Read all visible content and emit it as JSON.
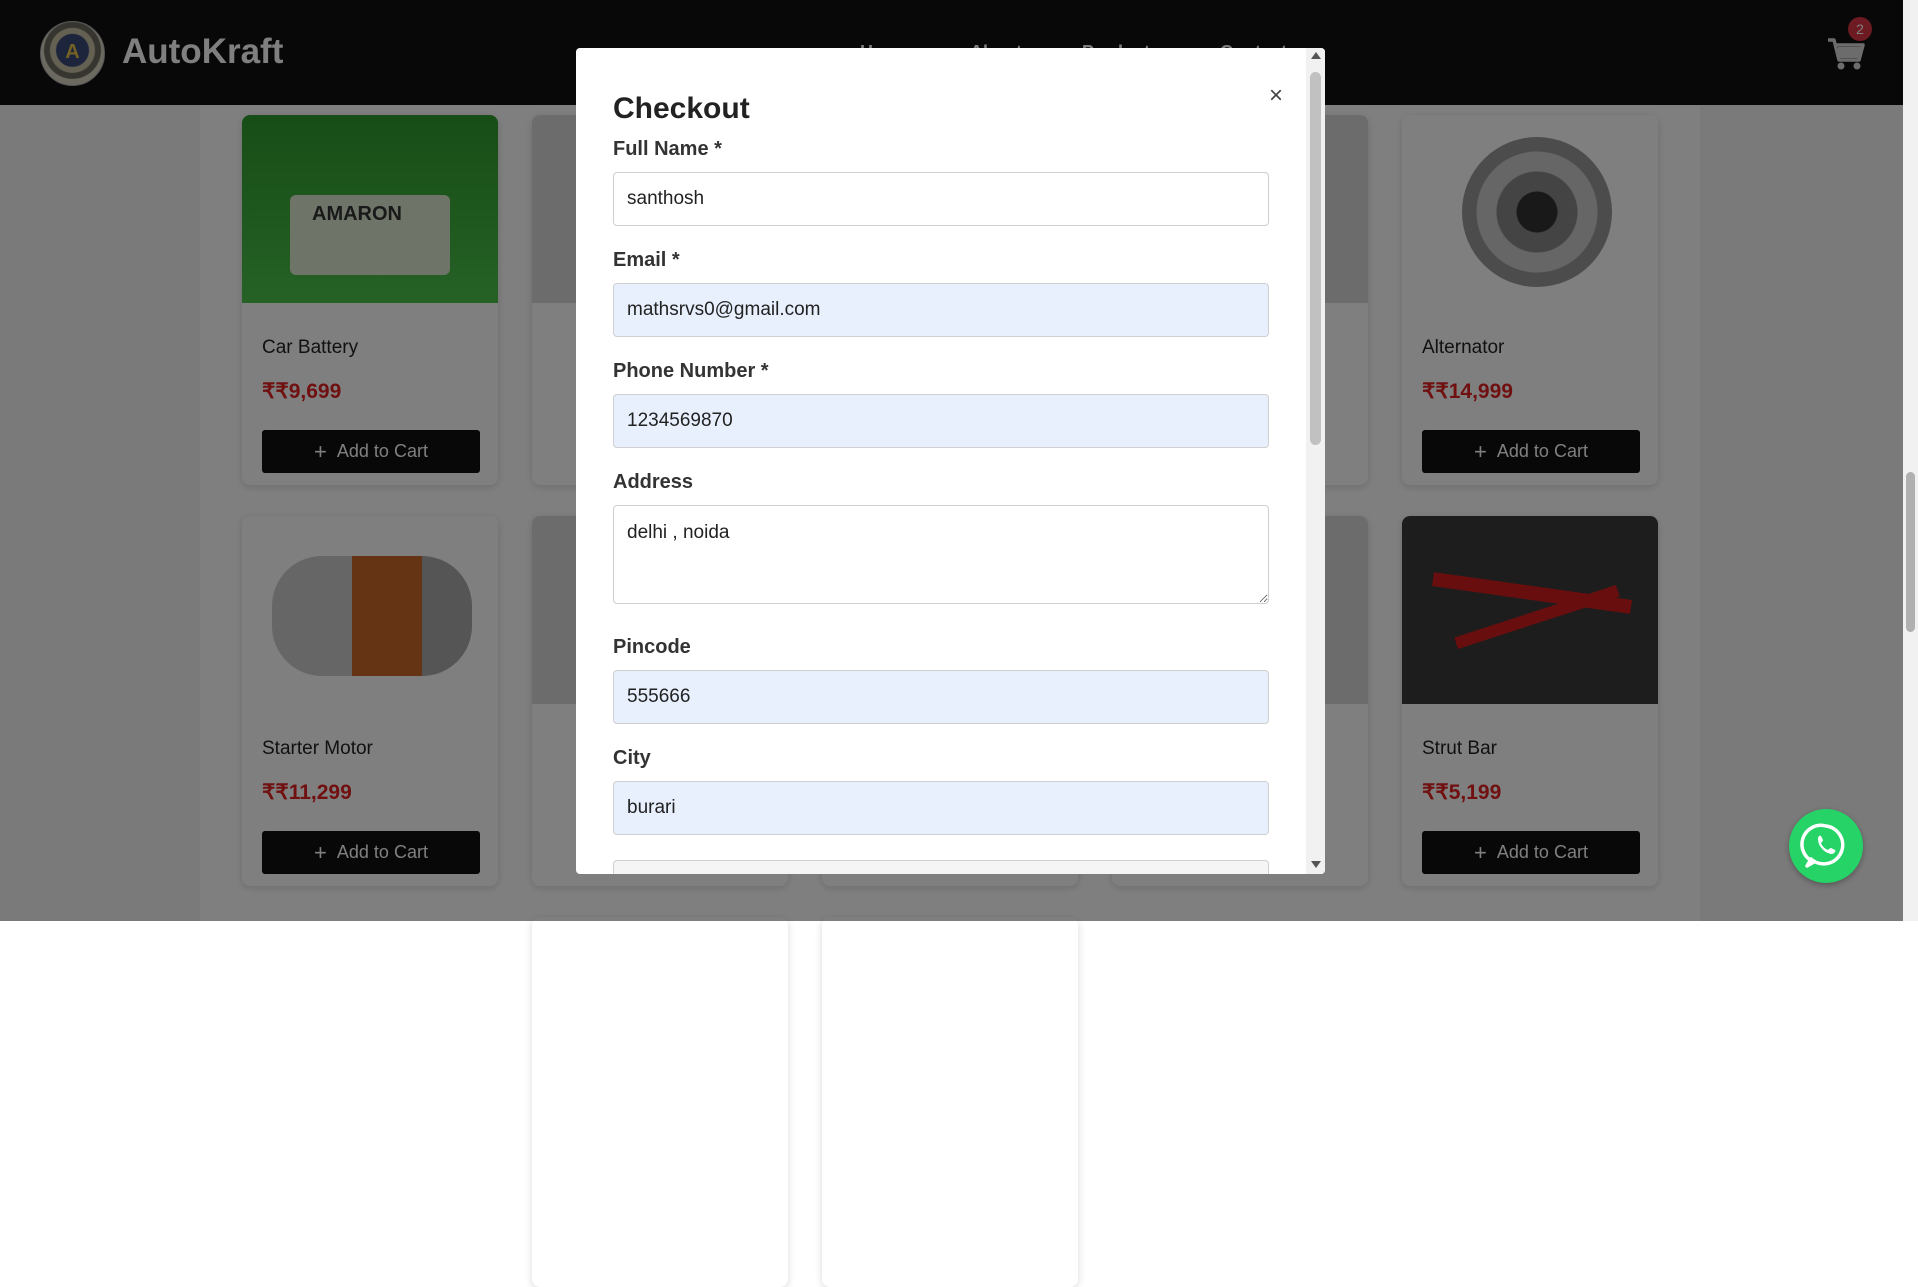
{
  "header": {
    "brand": "AutoKraft",
    "nav": [
      "Home",
      "About",
      "Products",
      "Contact"
    ],
    "cart_count": "2"
  },
  "products": [
    {
      "name": "Car Battery",
      "price": "₹₹9,699",
      "button": "Add to Cart",
      "image_text": "AMARON"
    },
    {
      "name": "Alternator",
      "price": "₹₹14,999",
      "button": "Add to Cart"
    },
    {
      "name": "Starter Motor",
      "price": "₹₹11,299",
      "button": "Add to Cart"
    },
    {
      "name": "Strut Bar",
      "price": "₹₹5,199",
      "button": "Add to Cart"
    }
  ],
  "checkout": {
    "title": "Checkout",
    "close": "×",
    "fields": [
      {
        "label": "Full Name *",
        "value": "santhosh"
      },
      {
        "label": "Email *",
        "value": "mathsrvs0@gmail.com"
      },
      {
        "label": "Phone Number *",
        "value": "1234569870"
      },
      {
        "label": "Address",
        "value": "delhi , noida"
      },
      {
        "label": "Pincode",
        "value": "555666"
      },
      {
        "label": "City",
        "value": "burari"
      }
    ]
  },
  "icons": {
    "cart": "cart-icon",
    "whatsapp": "whatsapp-icon",
    "close": "close-icon"
  },
  "colors": {
    "header_bg": "#111111",
    "price": "#e02020",
    "autofill_bg": "#e8f0fe",
    "whatsapp": "#25d366",
    "badge": "#dc3545"
  }
}
